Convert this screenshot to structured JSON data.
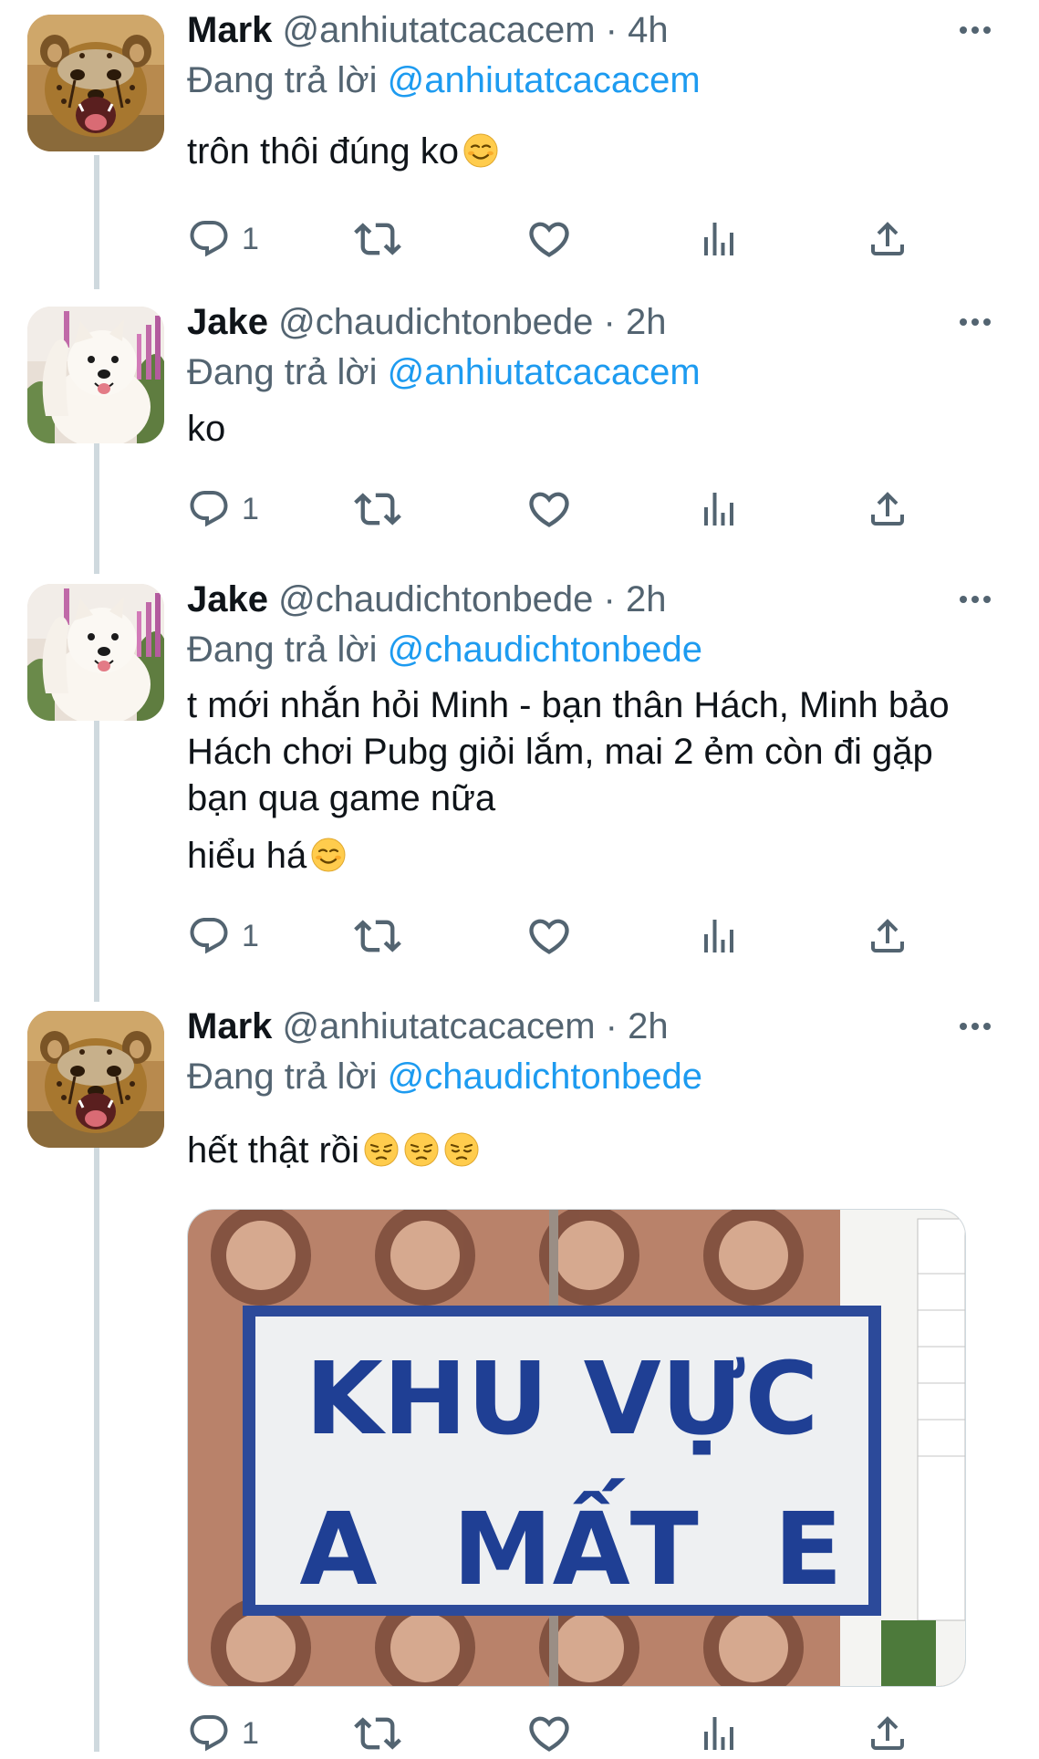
{
  "tweets": [
    {
      "display_name": "Mark",
      "handle": "@anhiutatcacacem",
      "separator": "·",
      "time": "4h",
      "reply_prefix": "Đang trả lời",
      "reply_to": "@anhiutatcacacem",
      "text": [
        "trôn thôi đúng ko"
      ],
      "reply_count": "1",
      "avatar": "cheetah-cub"
    },
    {
      "display_name": "Jake",
      "handle": "@chaudichtonbede",
      "separator": "·",
      "time": "2h",
      "reply_prefix": "Đang trả lời",
      "reply_to": "@anhiutatcacacem",
      "text": [
        "ko"
      ],
      "reply_count": "1",
      "avatar": "white-dog"
    },
    {
      "display_name": "Jake",
      "handle": "@chaudichtonbede",
      "separator": "·",
      "time": "2h",
      "reply_prefix": "Đang trả lời",
      "reply_to": "@chaudichtonbede",
      "text": [
        "t mới nhắn hỏi Minh - bạn thân Hách, Minh bảo Hách chơi Pubg giỏi lắm, mai 2 ẻm còn đi gặp bạn qua game nữa",
        "hiểu há"
      ],
      "reply_count": "1",
      "avatar": "white-dog"
    },
    {
      "display_name": "Mark",
      "handle": "@anhiutatcacacem",
      "separator": "·",
      "time": "2h",
      "reply_prefix": "Đang trả lời",
      "reply_to": "@chaudichtonbede",
      "text": [
        "hết thật rồi"
      ],
      "reply_count": "1",
      "avatar": "cheetah-cub",
      "media": {
        "sign_line1": "KHU VỰC",
        "sign_line2_left": "A",
        "sign_line2_mid": "MẤT",
        "sign_line2_right": "E"
      }
    }
  ],
  "icons": {
    "reply": "reply-icon",
    "retweet": "retweet-icon",
    "like": "heart-icon",
    "views": "views-icon",
    "share": "share-icon",
    "more": "more-icon",
    "emoji_smile": "smiling-face-emoji",
    "emoji_pensive": "pensive-face-emoji"
  },
  "colors": {
    "text_primary": "#0f1419",
    "text_secondary": "#536471",
    "link": "#1d9bf0",
    "thread_line": "#cfd9de",
    "sign_text": "#1f3f94"
  }
}
